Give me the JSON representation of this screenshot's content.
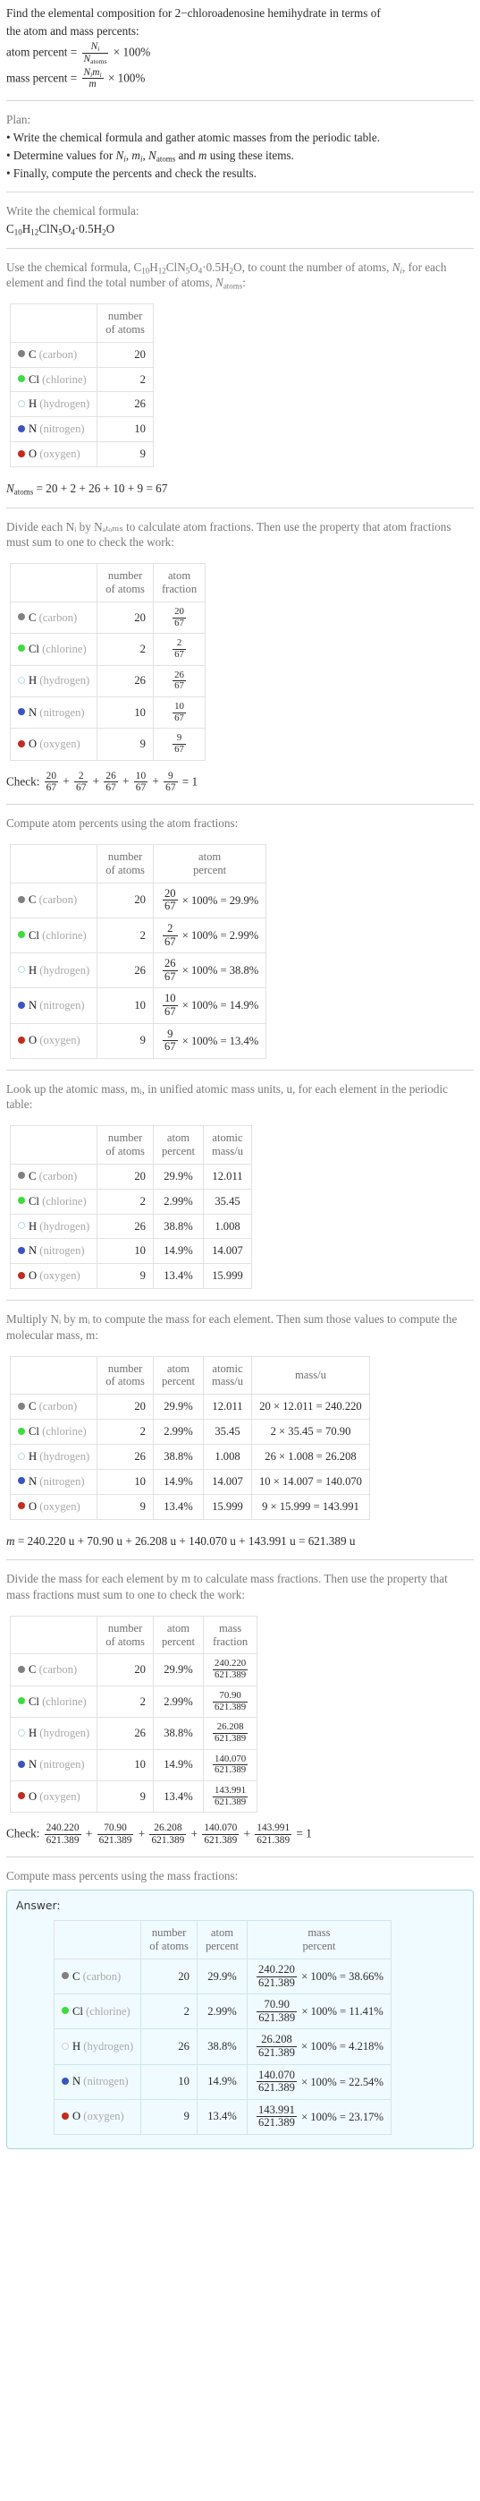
{
  "title": {
    "line1": "Find the elemental composition for 2−chloroadenosine hemihydrate in terms of",
    "line2": "the atom and mass percents:"
  },
  "definitions": {
    "atom_percent_label": "atom percent",
    "mass_percent_label": "mass percent",
    "equals": "=",
    "times": "×",
    "pct100": "100%",
    "Ni": "N",
    "Ni_sub": "i",
    "Natoms": "N",
    "Natoms_sub": "atoms",
    "mi": "m",
    "mi_sub": "i",
    "m": "m"
  },
  "plan": {
    "heading": "Plan:",
    "items": [
      "• Write the chemical formula and gather atomic masses from the periodic table.",
      "• Determine values for Nᵢ, mᵢ, Nₐₜₒₘₛ and m using these items.",
      "• Finally, compute the percents and check the results."
    ],
    "item2_parts": {
      "pre": "• Determine values for ",
      "mid1": ", ",
      "mid2": ", ",
      "mid3": " and ",
      "post": " using these items."
    },
    "item1": "• Write the chemical formula and gather atomic masses from the periodic table.",
    "item3": "• Finally, compute the percents and check the results."
  },
  "formula_section": {
    "heading": "Write the chemical formula:",
    "formula_plain": "C10H12ClN5O4·0.5H2O",
    "formula_parts": [
      {
        "t": "C",
        "sub": "10"
      },
      {
        "t": "H",
        "sub": "12"
      },
      {
        "t": "Cl",
        "sub": ""
      },
      {
        "t": "N",
        "sub": "5"
      },
      {
        "t": "O",
        "sub": "4"
      },
      {
        "t": "·0.5H",
        "sub": "2"
      },
      {
        "t": "O",
        "sub": ""
      }
    ]
  },
  "count_section": {
    "text_pre": "Use the chemical formula, ",
    "text_mid": ", to count the number of atoms, ",
    "text_post": ", for each element and find the total number of atoms, ",
    "text_end": ":",
    "header_number_of_atoms": "number\nof atoms",
    "sum_line": "Nₐₜₒₘₛ = 20 + 2 + 26 + 10 + 9 = 67",
    "sum_terms": [
      "20",
      "2",
      "26",
      "10",
      "9"
    ],
    "sum_total": "67"
  },
  "fraction_section": {
    "text": "Divide each Nᵢ by Nₐₜₒₘₛ to calculate atom fractions. Then use the property that atom fractions must sum to one to check the work:",
    "header_atom_fraction": "atom\nfraction",
    "check_label": "Check:",
    "check_result": "1"
  },
  "atom_percent_section": {
    "text": "Compute atom percents using the atom fractions:",
    "header_atom_percent": "atom\npercent"
  },
  "atomic_mass_section": {
    "text": "Look up the atomic mass, mᵢ, in unified atomic mass units, u, for each element in the periodic table:",
    "header_atomic_mass": "atomic\nmass/u"
  },
  "mass_section": {
    "text": "Multiply Nᵢ by mᵢ to compute the mass for each element. Then sum those values to compute the molecular mass, m:",
    "header_mass": "mass/u",
    "total_line": "m = 240.220 u + 70.90 u + 26.208 u + 140.070 u + 143.991 u = 621.389 u",
    "total_terms": [
      "240.220 u",
      "70.90 u",
      "26.208 u",
      "140.070 u",
      "143.991 u"
    ],
    "total_value": "621.389 u"
  },
  "mass_fraction_section": {
    "text": "Divide the mass for each element by m to calculate mass fractions. Then use the property that mass fractions must sum to one to check the work:",
    "header_mass_fraction": "mass\nfraction",
    "check_label": "Check:",
    "check_result": "1"
  },
  "mass_percent_section": {
    "text": "Compute mass percents using the mass fractions:",
    "header_mass_percent": "mass\npercent"
  },
  "answer": {
    "label": "Answer:"
  },
  "table_headers": {
    "blank": "",
    "number_of_atoms_l1": "number",
    "number_of_atoms_l2": "of atoms",
    "atom_fraction_l1": "atom",
    "atom_fraction_l2": "fraction",
    "atom_percent_l1": "atom",
    "atom_percent_l2": "percent",
    "atomic_mass_l1": "atomic",
    "atomic_mass_l2": "mass/u",
    "mass_l1": "mass/u",
    "mass_fraction_l1": "mass",
    "mass_fraction_l2": "fraction",
    "mass_percent_l1": "mass",
    "mass_percent_l2": "percent"
  },
  "denominator_atoms": "67",
  "denominator_mass": "621.389",
  "elements": [
    {
      "symbol": "C",
      "name": "(carbon)",
      "color": "#808080",
      "hollow": false,
      "count": "20",
      "atom_fraction_num": "20",
      "atom_fraction_den": "67",
      "atom_percent": "29.9%",
      "atomic_mass": "12.011",
      "mass_expr": "20 × 12.011 = 240.220",
      "mass_value": "240.220",
      "mass_fraction_num": "240.220",
      "mass_fraction_den": "621.389",
      "mass_percent": "38.66%"
    },
    {
      "symbol": "Cl",
      "name": "(chlorine)",
      "color": "#3ddc3d",
      "hollow": false,
      "count": "2",
      "atom_fraction_num": "2",
      "atom_fraction_den": "67",
      "atom_percent": "2.99%",
      "atomic_mass": "35.45",
      "mass_expr": "2 × 35.45 = 70.90",
      "mass_value": "70.90",
      "mass_fraction_num": "70.90",
      "mass_fraction_den": "621.389",
      "mass_percent": "11.41%"
    },
    {
      "symbol": "H",
      "name": "(hydrogen)",
      "color": "#ffffff",
      "hollow": true,
      "count": "26",
      "atom_fraction_num": "26",
      "atom_fraction_den": "67",
      "atom_percent": "38.8%",
      "atomic_mass": "1.008",
      "mass_expr": "26 × 1.008 = 26.208",
      "mass_value": "26.208",
      "mass_fraction_num": "26.208",
      "mass_fraction_den": "621.389",
      "mass_percent": "4.218%"
    },
    {
      "symbol": "N",
      "name": "(nitrogen)",
      "color": "#3b54c4",
      "hollow": false,
      "count": "10",
      "atom_fraction_num": "10",
      "atom_fraction_den": "67",
      "atom_percent": "14.9%",
      "atomic_mass": "14.007",
      "mass_expr": "10 × 14.007 = 140.070",
      "mass_value": "140.070",
      "mass_fraction_num": "140.070",
      "mass_fraction_den": "621.389",
      "mass_percent": "22.54%"
    },
    {
      "symbol": "O",
      "name": "(oxygen)",
      "color": "#c42b1c",
      "hollow": false,
      "count": "9",
      "atom_fraction_num": "9",
      "atom_fraction_den": "67",
      "atom_percent": "13.4%",
      "atomic_mass": "15.999",
      "mass_expr": "9 × 15.999 = 143.991",
      "mass_value": "143.991",
      "mass_fraction_num": "143.991",
      "mass_fraction_den": "621.389",
      "mass_percent": "23.17%"
    }
  ]
}
